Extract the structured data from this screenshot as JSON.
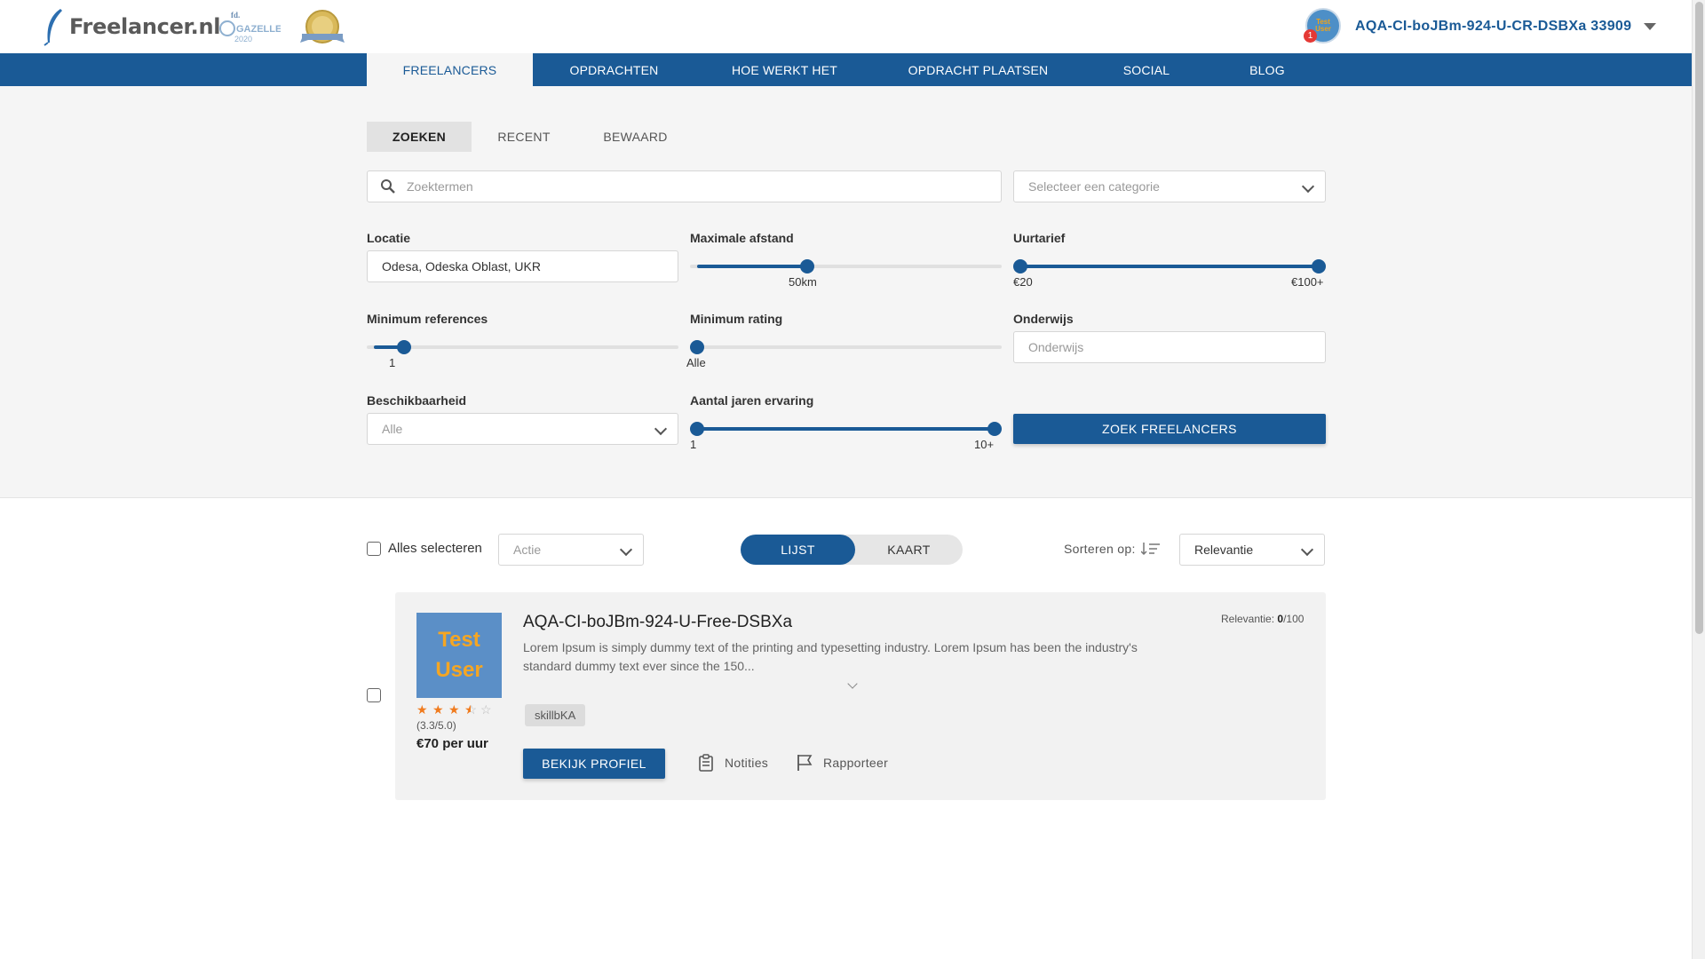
{
  "header": {
    "brand": "Freelancer.nl",
    "badge_gazellen_top": "fd.",
    "badge_gazellen_name": "GAZELLEN",
    "badge_gazellen_year": "2020",
    "user_name": "AQA-CI-boJBm-924-U-CR-DSBXa 33909",
    "notification_count": "1",
    "avatar_line1": "Test",
    "avatar_line2": "User"
  },
  "nav": {
    "items": [
      {
        "label": "FREELANCERS",
        "active": true
      },
      {
        "label": "OPDRACHTEN"
      },
      {
        "label": "HOE WERKT HET"
      },
      {
        "label": "OPDRACHT PLAATSEN"
      },
      {
        "label": "SOCIAL"
      },
      {
        "label": "BLOG"
      }
    ]
  },
  "subtabs": [
    "ZOEKEN",
    "RECENT",
    "BEWAARD"
  ],
  "search": {
    "keyword_placeholder": "Zoektermen",
    "category_placeholder": "Selecteer een categorie",
    "location_label": "Locatie",
    "location_value": "Odesa, Odeska Oblast, UKR",
    "distance_label": "Maximale afstand",
    "distance_value": "50km",
    "rate_label": "Uurtarief",
    "rate_min": "€20",
    "rate_max": "€100+",
    "references_label": "Minimum references",
    "references_value": "1",
    "rating_label": "Minimum rating",
    "rating_value": "Alle",
    "education_label": "Onderwijs",
    "education_placeholder": "Onderwijs",
    "availability_label": "Beschikbaarheid",
    "availability_value": "Alle",
    "experience_label": "Aantal jaren ervaring",
    "experience_min": "1",
    "experience_max": "10+",
    "submit_label": "ZOEK FREELANCERS"
  },
  "sliders": {
    "distance_fraction": 0.37,
    "rate_range": [
      0.0,
      1.0
    ],
    "references_fraction": 0.1,
    "rating_fraction": 0.0,
    "experience_range": [
      0.0,
      1.0
    ]
  },
  "results_toolbar": {
    "select_all_label": "Alles selecteren",
    "action_placeholder": "Actie",
    "view_list": "LIJST",
    "view_map": "KAART",
    "sort_label": "Sorteren op:",
    "sort_value": "Relevantie"
  },
  "results": [
    {
      "name": "AQA-CI-boJBm-924-U-Free-DSBXa",
      "avatar_line1": "Test",
      "avatar_line2": "User",
      "description": "Lorem Ipsum is simply dummy text of the printing and typesetting industry. Lorem Ipsum has been the industry's standard dummy text ever since the 150...",
      "rating": 3.3,
      "rating_text": "(3.3/5.0)",
      "price": "€70 per uur",
      "skill": "skillbKA",
      "relevance_label": "Relevantie:",
      "relevance_value": "0",
      "relevance_max": "/100",
      "view_profile": "BEKIJK PROFIEL",
      "notes": "Notities",
      "report": "Rapporteer"
    }
  ],
  "colors": {
    "primary": "#1a5a96",
    "star": "#f07b1e",
    "avatar_bg": "#5b8fc7",
    "avatar_text": "#f5a623"
  }
}
